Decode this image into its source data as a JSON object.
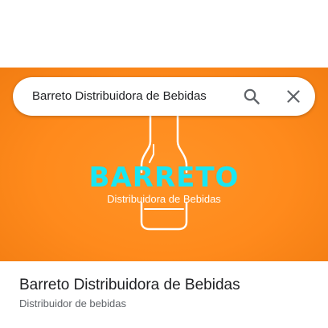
{
  "search": {
    "query": "Barreto Distribuidora de Bebidas"
  },
  "hero": {
    "logo_name": "BARRETO",
    "logo_subtitle": "Distribuidora de Bebidas",
    "background_color": "#ff8a1c",
    "logo_name_color": "#19e6f2"
  },
  "place": {
    "title": "Barreto Distribuidora de Bebidas",
    "category": "Distribuidor de bebidas"
  },
  "icons": {
    "search": "search-icon",
    "close": "close-icon"
  }
}
